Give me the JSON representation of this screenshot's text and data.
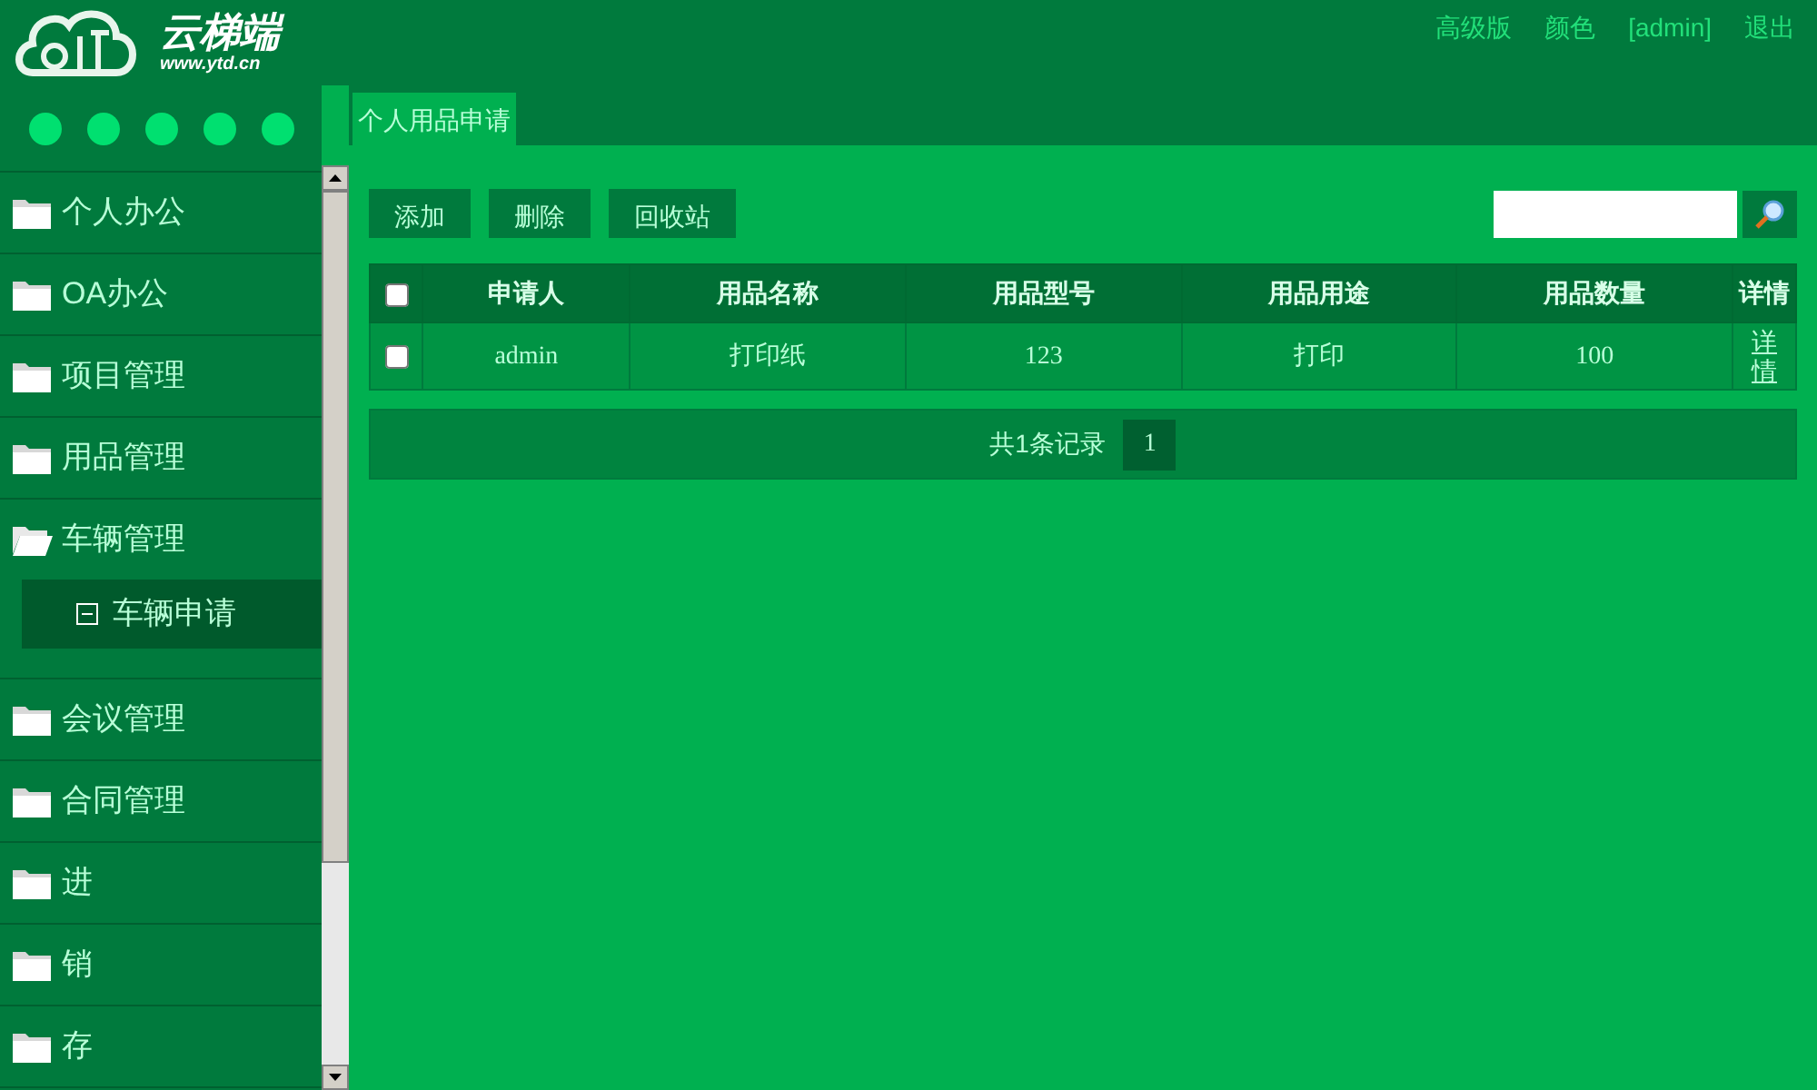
{
  "logo": {
    "name": "云梯端",
    "url": "www.ytd.cn"
  },
  "top_links": [
    "高级版",
    "颜色",
    "[admin]",
    "退出"
  ],
  "color_dots": [
    {
      "color": "#00e070"
    },
    {
      "color": "#00e070"
    },
    {
      "color": "#00e070"
    },
    {
      "color": "#00e070"
    },
    {
      "color": "#00e070"
    }
  ],
  "sidebar": {
    "items": [
      {
        "label": "个人办公",
        "expanded": false
      },
      {
        "label": "OA办公",
        "expanded": false
      },
      {
        "label": "项目管理",
        "expanded": false
      },
      {
        "label": "用品管理",
        "expanded": false
      },
      {
        "label": "车辆管理",
        "expanded": true,
        "children": [
          {
            "label": "车辆申请",
            "selected": true
          }
        ]
      },
      {
        "label": "会议管理",
        "expanded": false
      },
      {
        "label": "合同管理",
        "expanded": false
      },
      {
        "label": "进",
        "expanded": false
      },
      {
        "label": "销",
        "expanded": false
      },
      {
        "label": "存",
        "expanded": false
      }
    ]
  },
  "tabs": [
    {
      "label": "个人用品申请",
      "selected": true
    }
  ],
  "toolbar": {
    "buttons": [
      "添加",
      "删除",
      "回收站"
    ]
  },
  "table": {
    "select_all": {
      "checked": false
    },
    "columns": [
      "申请人",
      "用品名称",
      "用品型号",
      "用品用途",
      "用品数量",
      "详情"
    ],
    "rows": [
      {
        "checked": false,
        "cells": [
          "admin",
          "打印纸",
          "123",
          "打印",
          "100",
          "详情"
        ]
      }
    ]
  },
  "pagination": {
    "summary": "共1条记录",
    "pages": [
      {
        "label": "1",
        "selected": true
      }
    ]
  }
}
